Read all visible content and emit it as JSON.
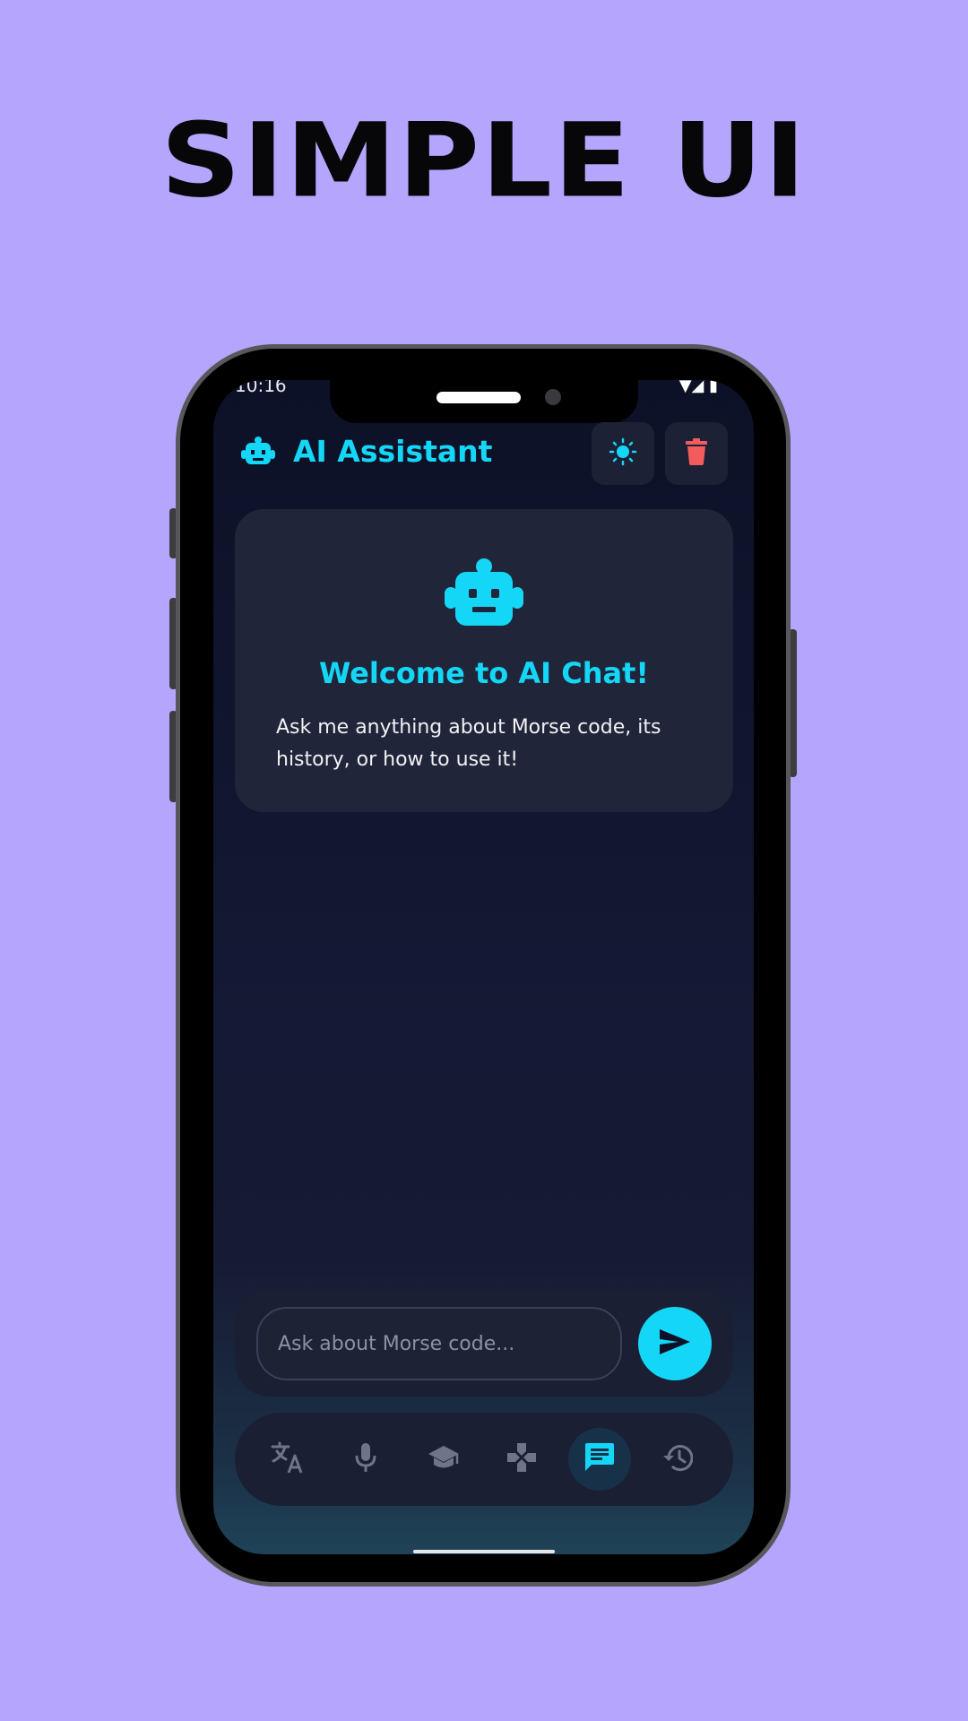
{
  "promo": {
    "headline": "SIMPLE UI"
  },
  "status_bar": {
    "time": "10:16",
    "icons": "▼◢ ▮"
  },
  "header": {
    "title": "AI Assistant",
    "icon": "robot-icon"
  },
  "actions": {
    "theme_icon": "sun-icon",
    "delete_icon": "trash-icon"
  },
  "welcome": {
    "title": "Welcome to AI Chat!",
    "message": "Ask me anything about Morse code, its history, or how to use it!"
  },
  "composer": {
    "placeholder": "Ask about Morse code...",
    "send_icon": "send-icon"
  },
  "nav": {
    "items": [
      {
        "icon": "translate-icon"
      },
      {
        "icon": "mic-icon"
      },
      {
        "icon": "school-icon"
      },
      {
        "icon": "gamepad-icon"
      },
      {
        "icon": "chat-icon",
        "active": true
      },
      {
        "icon": "history-icon"
      }
    ]
  },
  "colors": {
    "background": "#b6a5fc",
    "accent": "#14d7f7",
    "danger": "#f25c5c",
    "surface": "#20253a",
    "screen": "#0d1127"
  }
}
